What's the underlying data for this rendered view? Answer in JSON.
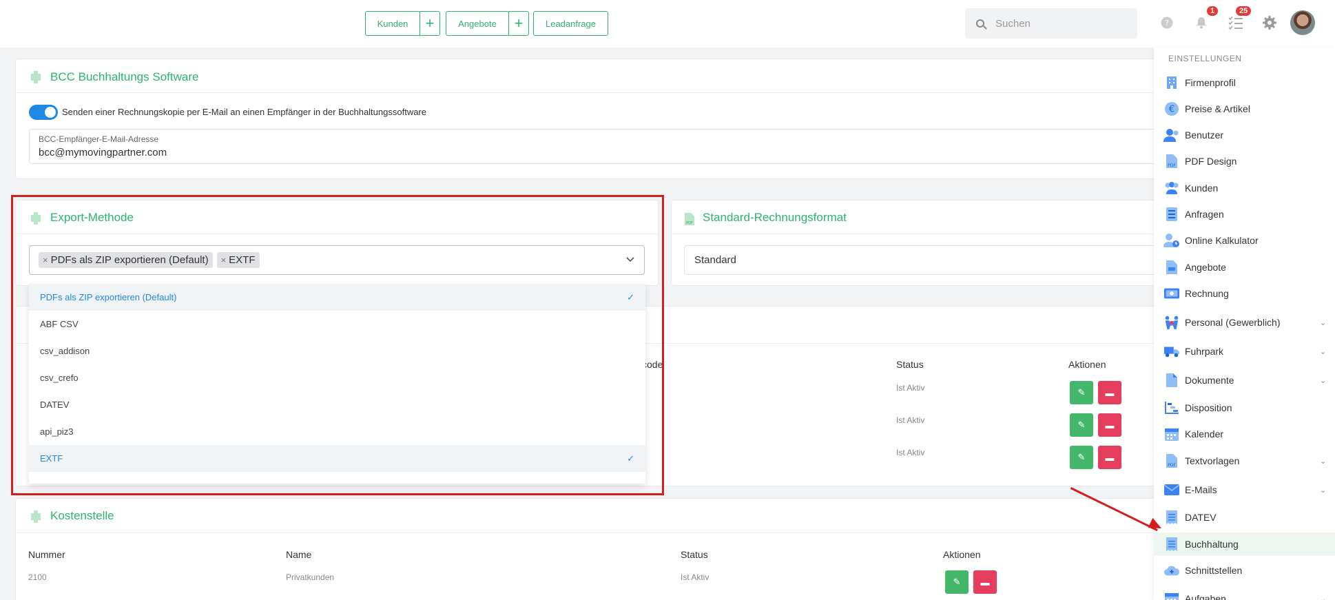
{
  "topbar": {
    "kunden_label": "Kunden",
    "angebote_label": "Angebote",
    "leadanfrage_label": "Leadanfrage",
    "plus_glyph": "+",
    "search_placeholder": "Suchen",
    "notifications_count": "1",
    "tasks_count": "25"
  },
  "bcc_card": {
    "title": "BCC Buchhaltungs Software",
    "toggle_text": "Senden einer Rechnungskopie per E-Mail an einen Empfänger in der Buchhaltungssoftware",
    "toggle_on": true,
    "email_label": "BCC-Empfänger-E-Mail-Adresse",
    "email_value": "bcc@mymovingpartner.com"
  },
  "export_card": {
    "title": "Export-Methode",
    "selected_chips": [
      "PDFs als ZIP exportieren (Default)",
      "EXTF"
    ],
    "options": [
      {
        "label": "PDFs als ZIP exportieren (Default)",
        "selected": true
      },
      {
        "label": "ABF CSV",
        "selected": false
      },
      {
        "label": "csv_addison",
        "selected": false
      },
      {
        "label": "csv_crefo",
        "selected": false
      },
      {
        "label": "DATEV",
        "selected": false
      },
      {
        "label": "api_piz3",
        "selected": false
      },
      {
        "label": "EXTF",
        "selected": true
      }
    ],
    "check_glyph": "✓"
  },
  "format_card": {
    "title": "Standard-Rechnungsformat",
    "value": "Standard"
  },
  "hidden_table": {
    "partial_header": "code",
    "status_header": "Status",
    "actions_header": "Aktionen",
    "rows": [
      {
        "status": "Ist Aktiv"
      },
      {
        "status": "Ist Aktiv"
      },
      {
        "status": "Ist Aktiv"
      }
    ]
  },
  "kostenstelle_card": {
    "title": "Kostenstelle",
    "headers": [
      "Nummer",
      "Name",
      "Status",
      "Aktionen"
    ],
    "rows": [
      {
        "nummer": "2100",
        "name": "Privatkunden",
        "status": "Ist Aktiv"
      }
    ]
  },
  "sidebar": {
    "heading": "EINSTELLUNGEN",
    "items": [
      {
        "label": "Firmenprofil",
        "icon": "building-icon",
        "chevron": false,
        "active": false
      },
      {
        "label": "Preise & Artikel",
        "icon": "euro-icon",
        "chevron": false,
        "active": false
      },
      {
        "label": "Benutzer",
        "icon": "user-icon",
        "chevron": false,
        "active": false
      },
      {
        "label": "PDF Design",
        "icon": "pdf-icon",
        "chevron": false,
        "active": false
      },
      {
        "label": "Kunden",
        "icon": "users-icon",
        "chevron": false,
        "active": false
      },
      {
        "label": "Anfragen",
        "icon": "list-icon",
        "chevron": false,
        "active": false
      },
      {
        "label": "Online Kalkulator",
        "icon": "user-clock-icon",
        "chevron": false,
        "active": false
      },
      {
        "label": "Angebote",
        "icon": "document-icon",
        "chevron": false,
        "active": false
      },
      {
        "label": "Rechnung",
        "icon": "money-icon",
        "chevron": false,
        "active": false
      },
      {
        "label": "Personal (Gewerblich)",
        "icon": "workers-icon",
        "chevron": true,
        "active": false
      },
      {
        "label": "Fuhrpark",
        "icon": "truck-icon",
        "chevron": true,
        "active": false
      },
      {
        "label": "Dokumente",
        "icon": "file-icon",
        "chevron": true,
        "active": false
      },
      {
        "label": "Disposition",
        "icon": "gantt-icon",
        "chevron": false,
        "active": false
      },
      {
        "label": "Kalender",
        "icon": "calendar-icon",
        "chevron": false,
        "active": false
      },
      {
        "label": "Textvorlagen",
        "icon": "pdf-icon",
        "chevron": true,
        "active": false
      },
      {
        "label": "E-Mails",
        "icon": "envelope-icon",
        "chevron": true,
        "active": false
      },
      {
        "label": "DATEV",
        "icon": "receipt-icon",
        "chevron": false,
        "active": false
      },
      {
        "label": "Buchhaltung",
        "icon": "receipt-icon",
        "chevron": false,
        "active": true
      },
      {
        "label": "Schnittstellen",
        "icon": "cloud-plus-icon",
        "chevron": false,
        "active": false
      },
      {
        "label": "Aufgaben",
        "icon": "calendar-icon",
        "chevron": true,
        "active": false
      }
    ],
    "chevron_glyph": "⌄"
  },
  "colors": {
    "accent_green": "#2bb56b",
    "toggle_blue": "#1e88e5",
    "annotation_red": "#d21f1f",
    "delete_red": "#e53e5c"
  }
}
